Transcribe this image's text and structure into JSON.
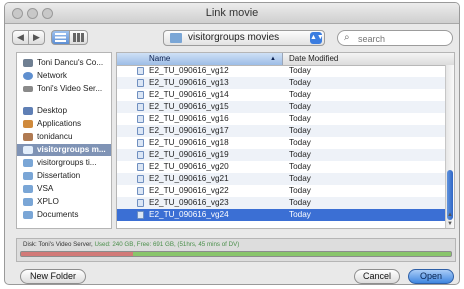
{
  "window": {
    "title": "Link movie"
  },
  "toolbar": {
    "back_glyph": "◀",
    "forward_glyph": "▶"
  },
  "location": {
    "current": "visitorgroups movies"
  },
  "search": {
    "placeholder": "search"
  },
  "sidebar": {
    "items": [
      {
        "label": "Toni Dancu's Co...",
        "icon": "computer-icon",
        "color": "#6f7f92"
      },
      {
        "label": "Network",
        "icon": "network-icon",
        "color": "#5f8fcf"
      },
      {
        "label": "Toni's Video Ser...",
        "icon": "drive-icon",
        "color": "#8a8a8a"
      },
      {
        "label": "Desktop",
        "icon": "desktop-icon",
        "color": "#5f7fb5"
      },
      {
        "label": "Applications",
        "icon": "applications-icon",
        "color": "#d08a3c"
      },
      {
        "label": "tonidancu",
        "icon": "home-icon",
        "color": "#b07a52"
      },
      {
        "label": "visitorgroups m...",
        "icon": "folder-icon",
        "color": "#e3eefb",
        "selected": true
      },
      {
        "label": "visitorgroups ti...",
        "icon": "folder-icon",
        "color": "#7aa6d6"
      },
      {
        "label": "Dissertation",
        "icon": "folder-icon",
        "color": "#7aa6d6"
      },
      {
        "label": "VSA",
        "icon": "folder-icon",
        "color": "#7aa6d6"
      },
      {
        "label": "XPLO",
        "icon": "folder-icon",
        "color": "#7aa6d6"
      },
      {
        "label": "Documents",
        "icon": "documents-icon",
        "color": "#7aa6d6"
      }
    ]
  },
  "filelist": {
    "columns": {
      "name": "Name",
      "date": "Date Modified"
    },
    "rows": [
      {
        "name": "E2_TU_090616_vg12",
        "date": "Today"
      },
      {
        "name": "E2_TU_090616_vg13",
        "date": "Today"
      },
      {
        "name": "E2_TU_090616_vg14",
        "date": "Today"
      },
      {
        "name": "E2_TU_090616_vg15",
        "date": "Today"
      },
      {
        "name": "E2_TU_090616_vg16",
        "date": "Today"
      },
      {
        "name": "E2_TU_090616_vg17",
        "date": "Today"
      },
      {
        "name": "E2_TU_090616_vg18",
        "date": "Today"
      },
      {
        "name": "E2_TU_090616_vg19",
        "date": "Today"
      },
      {
        "name": "E2_TU_090616_vg20",
        "date": "Today"
      },
      {
        "name": "E2_TU_090616_vg21",
        "date": "Today"
      },
      {
        "name": "E2_TU_090616_vg22",
        "date": "Today"
      },
      {
        "name": "E2_TU_090616_vg23",
        "date": "Today"
      },
      {
        "name": "E2_TU_090616_vg24",
        "date": "Today",
        "selected": true
      }
    ]
  },
  "status": {
    "disk_label": "Disk: Toni's Video Server,",
    "used": "Used: 240 GB,",
    "free": "Free: 691 GB, (51hrs, 45 mins of DV)",
    "used_fraction": 0.26
  },
  "buttons": {
    "new_folder": "New Folder",
    "cancel": "Cancel",
    "open": "Open"
  },
  "colors": {
    "selection": "#3b6fd4",
    "primary_button": "#3f86e0"
  }
}
